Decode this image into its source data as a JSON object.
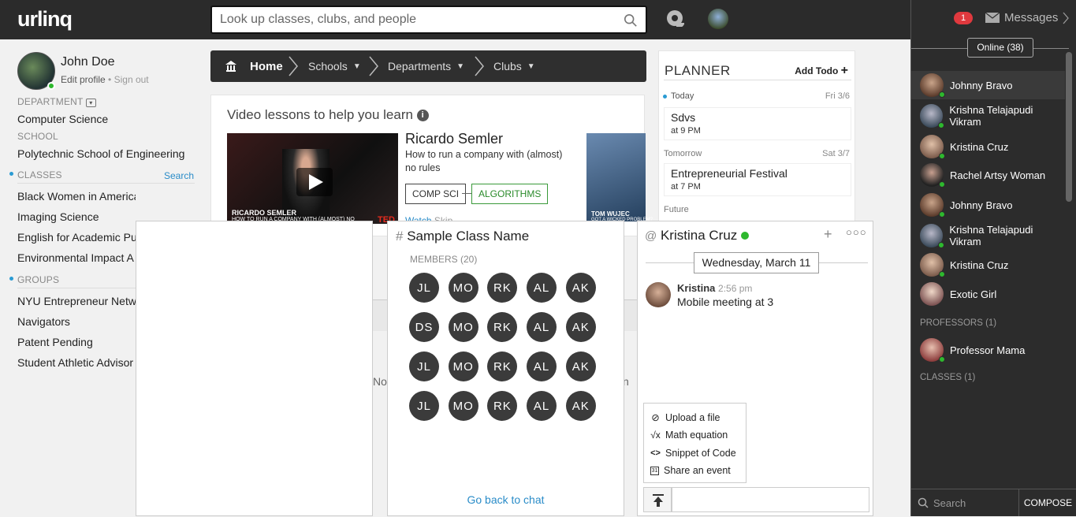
{
  "brand": {
    "logo": "urlinq"
  },
  "search": {
    "placeholder": "Look up classes, clubs, and people"
  },
  "user": {
    "name": "John Doe",
    "edit_profile": "Edit profile",
    "sign_out": "Sign out"
  },
  "sidebar": {
    "department_label": "DEPARTMENT",
    "department": "Computer Science",
    "school_label": "SCHOOL",
    "school": "Polytechnic School of Engineering",
    "classes_label": "CLASSES",
    "classes_search": "Search",
    "classes": [
      "Black Women in America",
      "Imaging Science",
      "English for Academic Pu",
      "Environmental Impact A"
    ],
    "groups_label": "GROUPS",
    "groups": [
      "NYU Entrepreneur Netw",
      "Navigators",
      "Patent Pending",
      "Student Athletic Advisor"
    ]
  },
  "breadcrumb": {
    "home": "Home",
    "schools": "Schools",
    "departments": "Departments",
    "clubs": "Clubs"
  },
  "video_card": {
    "title": "Video lessons to help you learn",
    "speaker": "Ricardo Semler",
    "talk": "How to run a company with (almost) no rules",
    "tag1": "COMP SCI",
    "tag2": "ALGORITHMS",
    "watch": "Watch",
    "skip": "Skip",
    "caption1": "RICARDO SEMLER",
    "caption2": "HOW TO RUN A COMPANY WITH (ALMOST) NO",
    "ted": "TED",
    "caption3": "TOM WUJEC",
    "caption4": "GOT A WICKED PROBLEM?"
  },
  "planner": {
    "title": "PLANNER",
    "add": "Add Todo",
    "today": "Today",
    "today_date": "Fri 3/6",
    "ev1_title": "Sdvs",
    "ev1_time": "at 9 PM",
    "tomorrow": "Tomorrow",
    "tomorrow_date": "Sat 3/7",
    "ev2_title": "Entrepreneurial Festival",
    "ev2_time": "at 7 PM",
    "future": "Future"
  },
  "class_panel": {
    "hash": "#",
    "title": "Sample Class Name",
    "members_label": "MEMBERS (20)",
    "members": [
      "JL",
      "MO",
      "RK",
      "AL",
      "AK",
      "DS",
      "MO",
      "RK",
      "AL",
      "AK",
      "JL",
      "MO",
      "RK",
      "AL",
      "AK",
      "JL",
      "MO",
      "RK",
      "AL",
      "AK"
    ],
    "back": "Go back to chat"
  },
  "chat": {
    "at": "@",
    "name": "Kristina Cruz",
    "date": "Wednesday, March 11",
    "msg_author": "Kristina",
    "msg_time": "2:56 pm",
    "msg_text": "Mobile meeting at 3",
    "menu": [
      "Upload a file",
      "Math equation",
      "Snippet of Code",
      "Share an event"
    ]
  },
  "peek": {
    "left": "No",
    "right": "n"
  },
  "messages": {
    "badge": "1",
    "label": "Messages",
    "online": "Online (38)",
    "contacts": [
      "Johnny Bravo",
      "Krishna Telajapudi Vikram",
      "Kristina Cruz",
      "Rachel Artsy Woman",
      "Johnny Bravo",
      "Krishna Telajapudi Vikram",
      "Kristina Cruz",
      "Exotic Girl"
    ],
    "professors_label": "PROFESSORS (1)",
    "professors": [
      "Professor Mama"
    ],
    "classes_label": "CLASSES (1)",
    "search": "Search",
    "compose": "COMPOSE"
  }
}
